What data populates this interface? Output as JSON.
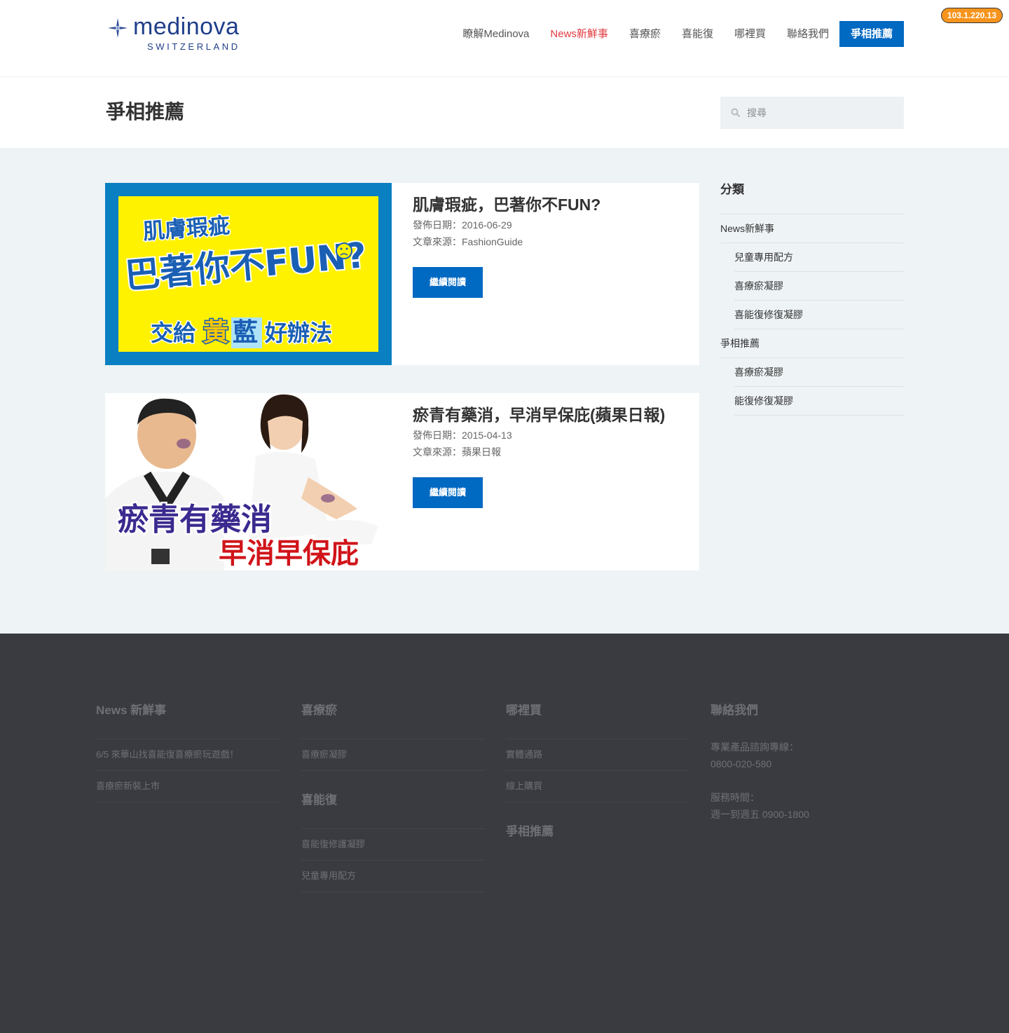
{
  "brand": {
    "name": "medinova",
    "tagline": "SWITZERLAND"
  },
  "ip_badge": "103.1.220.13",
  "nav": {
    "items": [
      "瞭解Medinova",
      "News新鮮事",
      "喜療瘀",
      "喜能復",
      "哪裡買",
      "聯絡我們"
    ],
    "active_index": 1,
    "cta": "爭相推薦"
  },
  "page": {
    "title": "爭相推薦"
  },
  "search": {
    "placeholder": "搜尋"
  },
  "posts": [
    {
      "title": "肌膚瑕疵，巴著你不FUN?",
      "date": "發佈日期：2016-06-29",
      "source": "文章來源：FashionGuide",
      "button": "繼續閱讀",
      "image_text": {
        "line1": "肌膚瑕疵",
        "line2": "巴著你不FUN?",
        "line3a": "交給",
        "line3b": "黃",
        "line3c": "藍",
        "line3d": "好辦法"
      }
    },
    {
      "title": "瘀青有藥消，早消早保庇(蘋果日報)",
      "date": "發佈日期：2015-04-13",
      "source": "文章來源：蘋果日報",
      "button": "繼續閱讀",
      "image_text": {
        "line1": "瘀青有藥消",
        "line2": "早消早保庇"
      }
    }
  ],
  "sidebar": {
    "heading": "分類",
    "items": [
      {
        "label": "News新鮮事",
        "child": false
      },
      {
        "label": "兒童專用配方",
        "child": true
      },
      {
        "label": "喜療瘀凝膠",
        "child": true
      },
      {
        "label": "喜能復修復凝膠",
        "child": true
      },
      {
        "label": "爭相推薦",
        "child": false
      },
      {
        "label": "喜療瘀凝膠",
        "child": true
      },
      {
        "label": "能復修復凝膠",
        "child": true
      }
    ]
  },
  "footer": {
    "news": {
      "heading": "News 新鮮事",
      "items": [
        "6/5 來華山找喜能復喜療瘀玩遊戲！",
        "喜療瘀新裝上市"
      ]
    },
    "xiliaoyu": {
      "heading": "喜療瘀",
      "items": [
        "喜療瘀凝膠"
      ]
    },
    "xinengfu": {
      "heading": "喜能復",
      "items": [
        "喜能復修護凝膠",
        "兒童專用配方"
      ]
    },
    "where": {
      "heading": "哪裡買",
      "items": [
        "實體通路",
        "線上購買"
      ]
    },
    "recommend": {
      "heading": "爭相推薦"
    },
    "contact": {
      "heading": "聯絡我們",
      "hotline_label": "專業產品諮詢專線：",
      "hotline": "0800-020-580",
      "hours_label": "服務時間：",
      "hours": "週一到週五 0900-1800"
    }
  },
  "colors": {
    "brand_blue": "#0069c2",
    "active_red": "#e03a3e",
    "logo_navy": "#1f3f8a",
    "footer_bg": "#3a3b41",
    "main_bg": "#eef3f6"
  }
}
